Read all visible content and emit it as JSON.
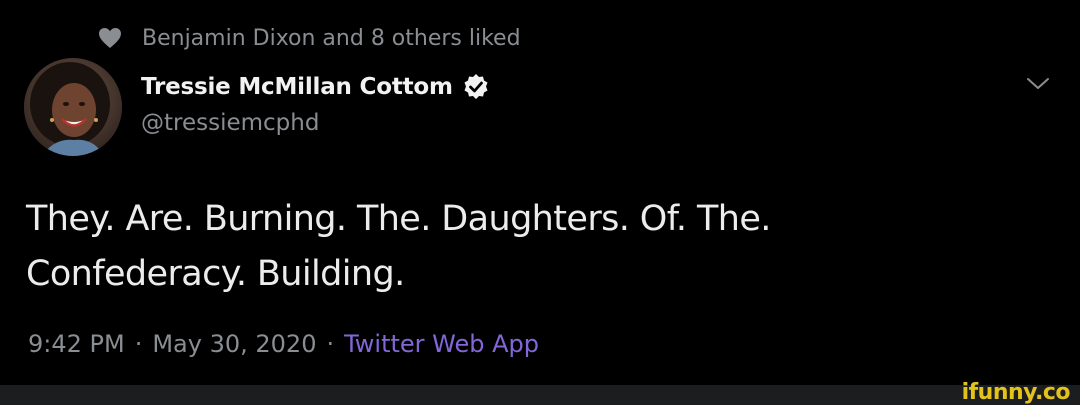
{
  "social_context": {
    "icon": "heart-icon",
    "text": "Benjamin Dixon and 8 others liked"
  },
  "author": {
    "display_name": "Tressie McMillan Cottom",
    "handle": "@tressiemcphd",
    "verified_icon": "verified-badge-icon"
  },
  "tweet": {
    "line1": "They. Are. Burning. The. Daughters. Of. The.",
    "line2": "Confederacy. Building."
  },
  "meta": {
    "time": "9:42 PM",
    "date": "May 30, 2020",
    "source": "Twitter Web App",
    "separator": "·"
  },
  "watermark": "ifunny.co",
  "colors": {
    "background": "#000000",
    "secondary_text": "#8a8d91",
    "source_link": "#8267d8",
    "watermark": "#e3c21a"
  }
}
